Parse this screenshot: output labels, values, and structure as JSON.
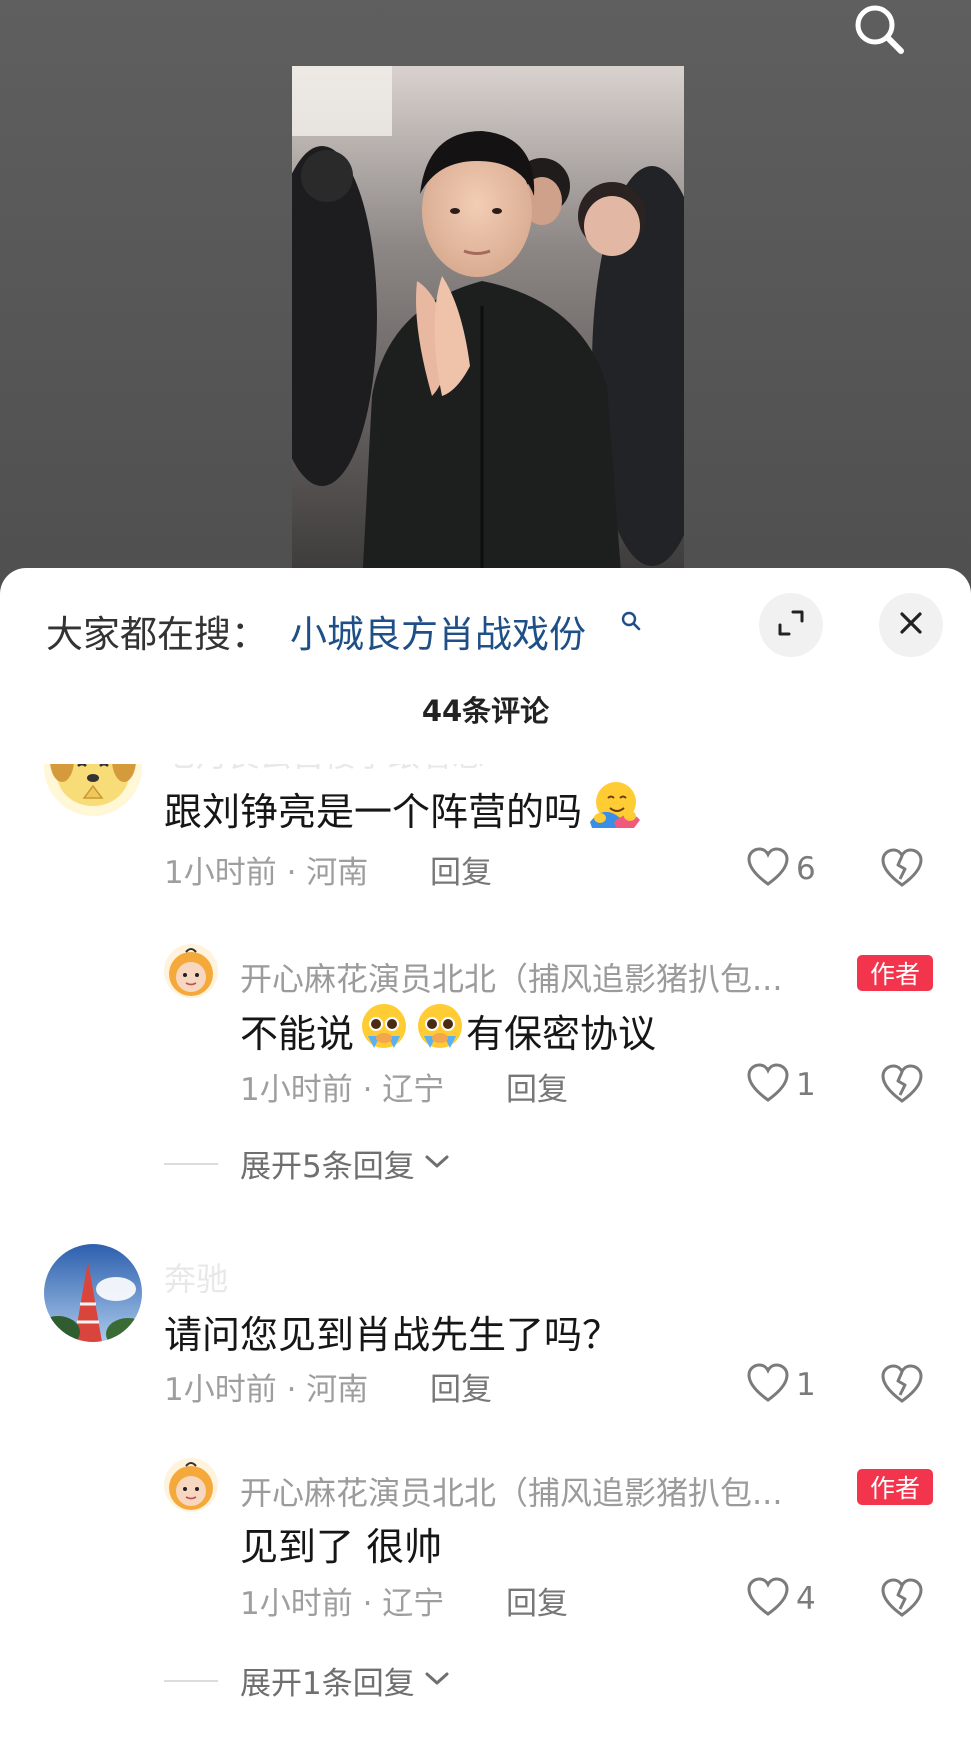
{
  "top": {
    "search_icon": "search-icon"
  },
  "sheet": {
    "trend_prefix": "大家都在搜：",
    "trend_query": "小城良方肖战戏份",
    "expand_icon": "expand-icon",
    "close_icon": "close-icon",
    "comment_count": "44条评论"
  },
  "comments": [
    {
      "user": "七月良云自楼了跟看忘",
      "text": "跟刘铮亮是一个阵营的吗",
      "emoji": "hugging-face",
      "time_loc": "1小时前 · 河南",
      "reply_label": "回复",
      "likes": "6",
      "reply": {
        "user": "开心麻花演员北北（捕风追影猪扒包...",
        "badge": "作者",
        "text": "不能说",
        "text_after": "有保密协议",
        "emoji": "pleading-face",
        "time_loc": "1小时前 · 辽宁",
        "reply_label": "回复",
        "likes": "1"
      },
      "expand_label": "展开5条回复"
    },
    {
      "user": "奔驰",
      "text": "请问您见到肖战先生了吗？",
      "time_loc": "1小时前 · 河南",
      "reply_label": "回复",
      "likes": "1",
      "reply": {
        "user": "开心麻花演员北北（捕风追影猪扒包...",
        "badge": "作者",
        "text": "见到了 很帅",
        "time_loc": "1小时前 · 辽宁",
        "reply_label": "回复",
        "likes": "4"
      },
      "expand_label": "展开1条回复"
    }
  ],
  "colors": {
    "accent_link": "#1e4f86",
    "author_badge": "#f2354d",
    "meta_gray": "#9e9e9e"
  }
}
